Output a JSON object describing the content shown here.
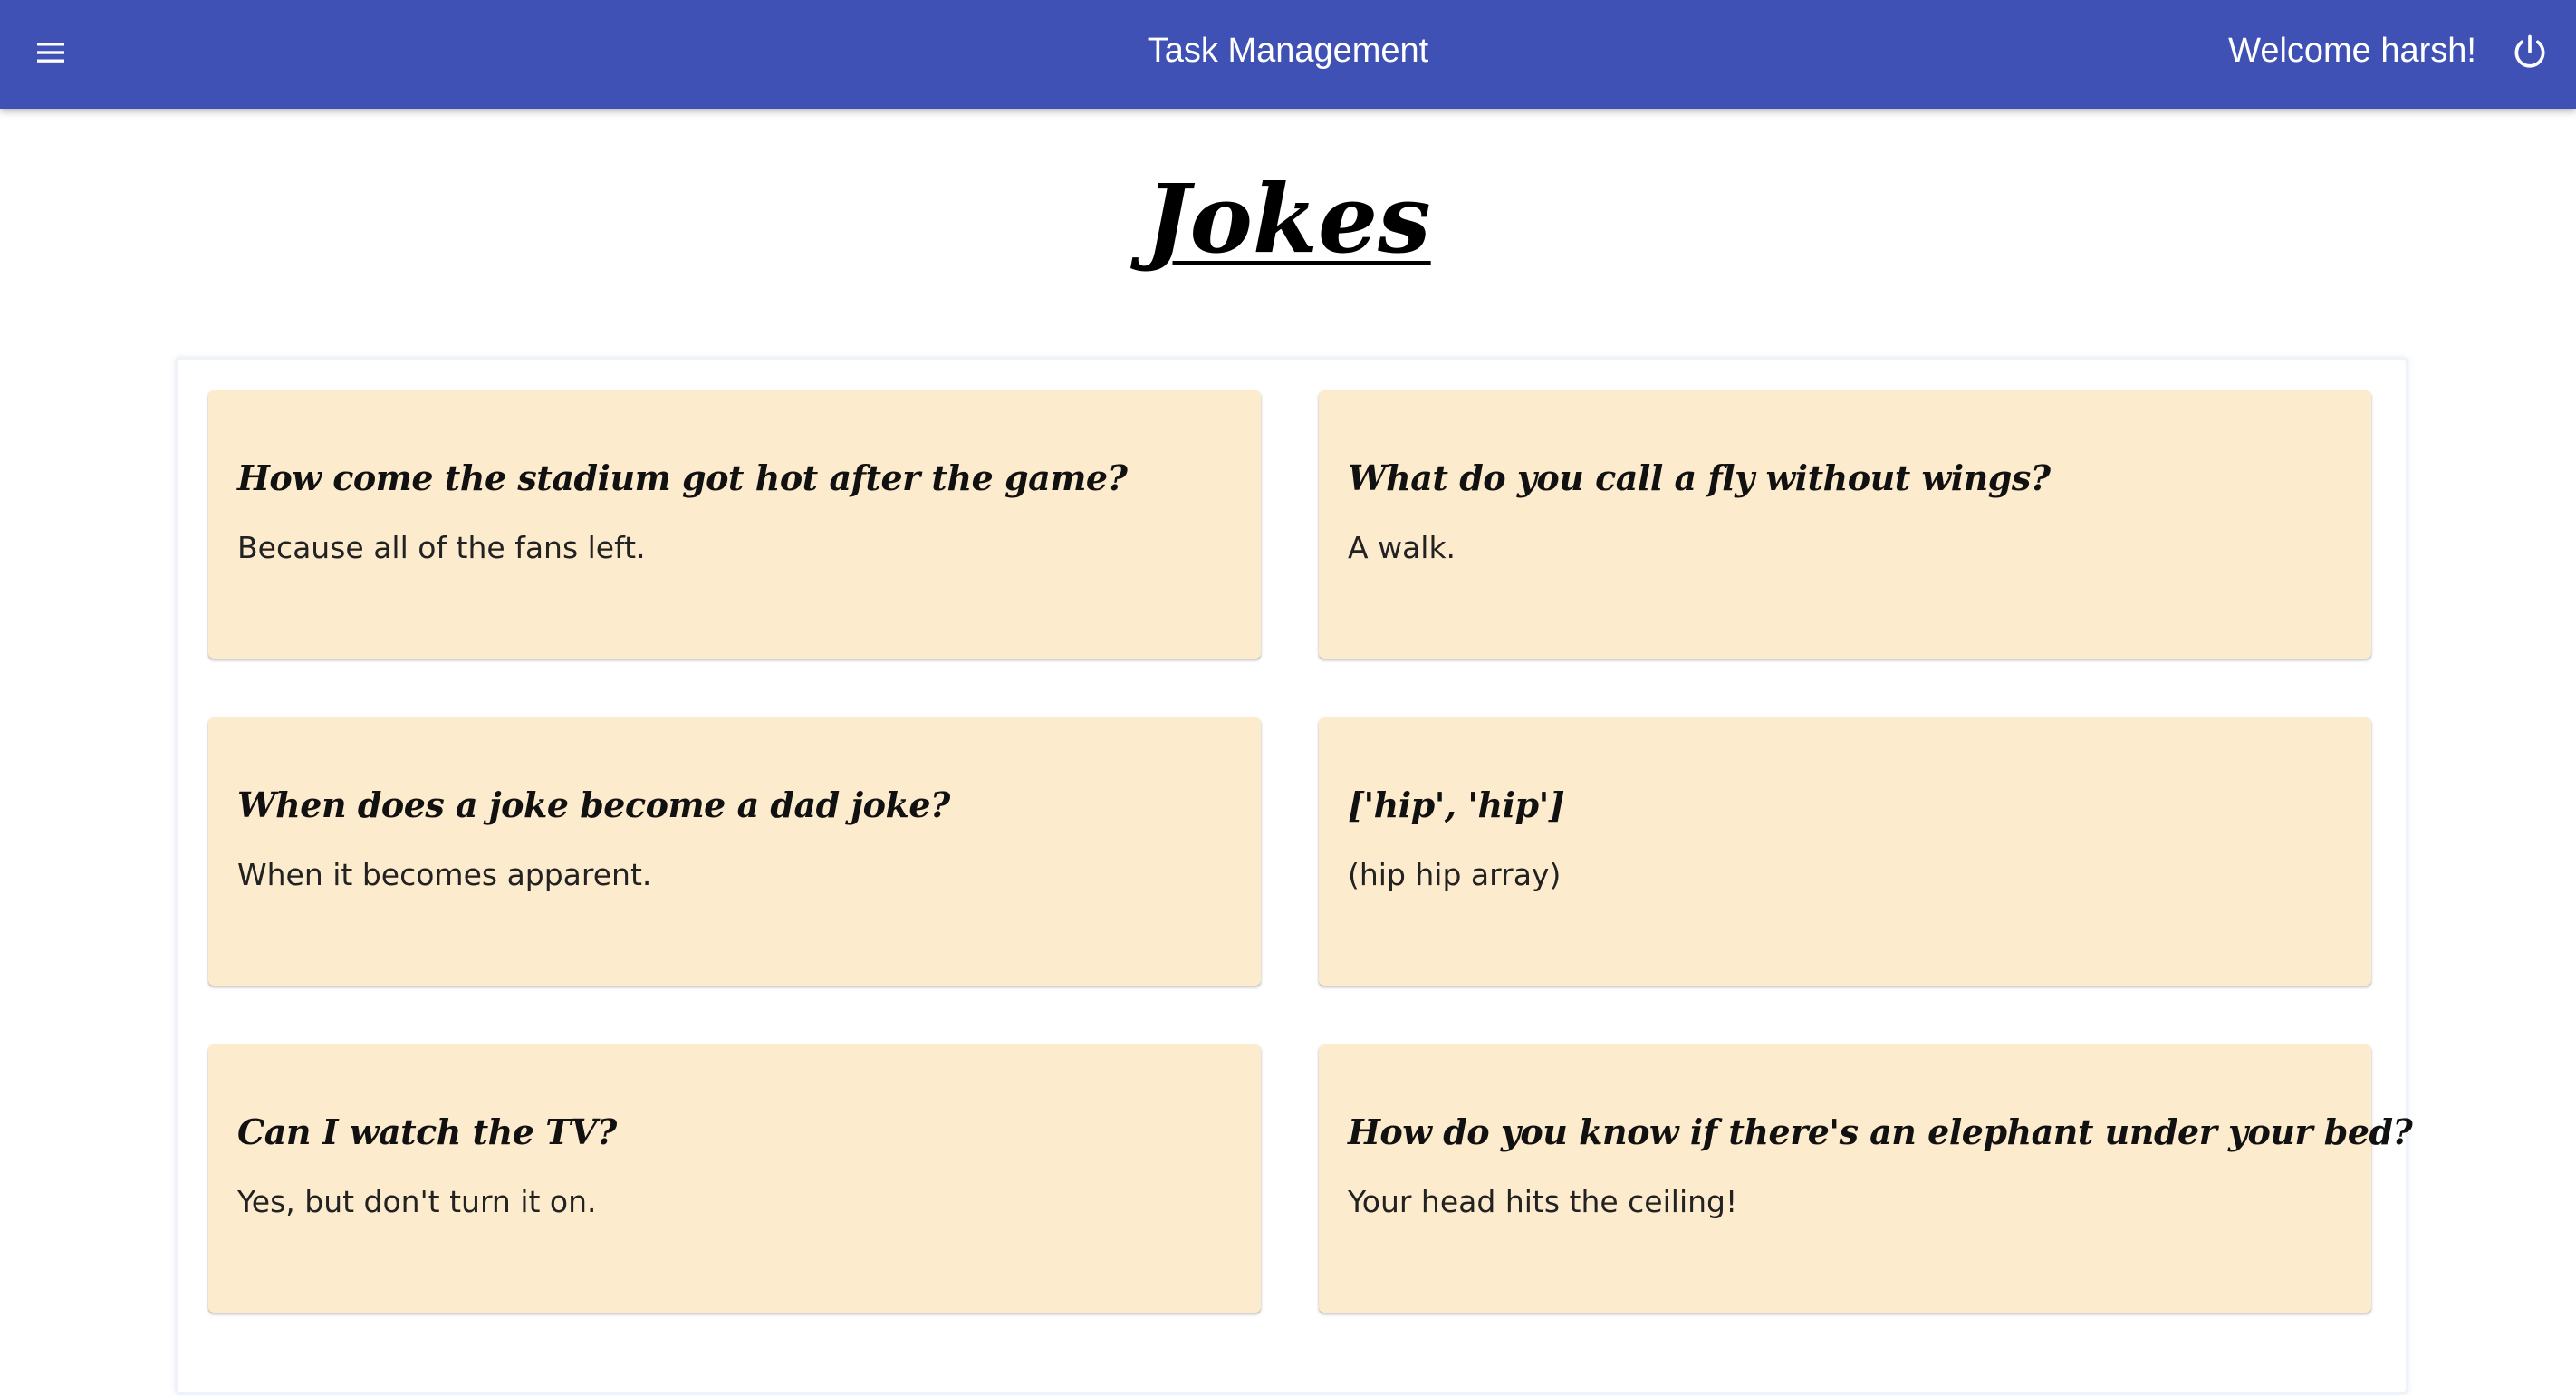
{
  "appbar": {
    "title": "Task Management",
    "welcome": "Welcome harsh!",
    "menu_icon": "menu-icon",
    "power_icon": "power-icon",
    "color": "#3f51b5"
  },
  "page": {
    "heading": "Jokes"
  },
  "jokes": [
    {
      "question": "How come the stadium got hot after the game?",
      "answer": "Because all of the fans left."
    },
    {
      "question": "What do you call a fly without wings?",
      "answer": "A walk."
    },
    {
      "question": "When does a joke become a dad joke?",
      "answer": "When it becomes apparent."
    },
    {
      "question": "['hip', 'hip']",
      "answer": "(hip hip array)"
    },
    {
      "question": "Can I watch the TV?",
      "answer": "Yes, but don't turn it on."
    },
    {
      "question": "How do you know if there's an elephant under your bed?",
      "answer": "Your head hits the ceiling!"
    }
  ],
  "card_color": "#fdebcd"
}
